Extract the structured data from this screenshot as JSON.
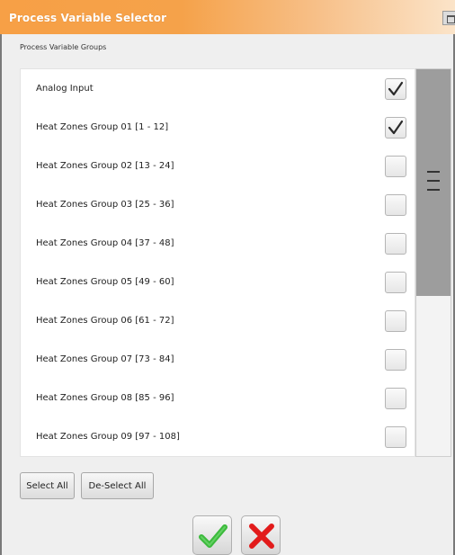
{
  "window": {
    "title": "Process Variable Selector"
  },
  "groups_label": "Process Variable Groups",
  "items": [
    {
      "label": "Analog Input",
      "checked": true
    },
    {
      "label": "Heat Zones Group 01 [1 - 12]",
      "checked": true
    },
    {
      "label": "Heat Zones Group 02 [13 - 24]",
      "checked": false
    },
    {
      "label": "Heat Zones Group 03 [25 - 36]",
      "checked": false
    },
    {
      "label": "Heat Zones Group 04 [37 - 48]",
      "checked": false
    },
    {
      "label": "Heat Zones Group 05 [49 - 60]",
      "checked": false
    },
    {
      "label": "Heat Zones Group 06 [61 - 72]",
      "checked": false
    },
    {
      "label": "Heat Zones Group 07 [73 - 84]",
      "checked": false
    },
    {
      "label": "Heat Zones Group 08 [85 - 96]",
      "checked": false
    },
    {
      "label": "Heat Zones Group 09 [97 - 108]",
      "checked": false
    }
  ],
  "buttons": {
    "select_all": "Select All",
    "deselect_all": "De-Select All",
    "ok_icon": "checkmark-icon",
    "cancel_icon": "x-icon"
  },
  "colors": {
    "title_bar": "#f7a046",
    "ok": "#3cba3c",
    "cancel": "#e21b1b"
  }
}
